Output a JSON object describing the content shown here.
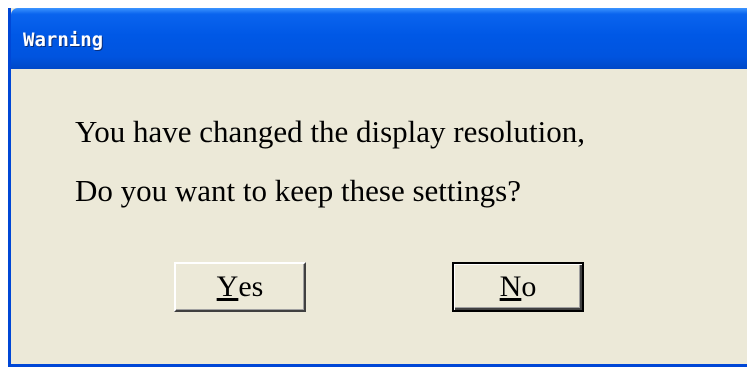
{
  "window": {
    "title": "Warning"
  },
  "message": {
    "line1": "You have changed the display resolution,",
    "line2": "Do you want to keep these settings?"
  },
  "buttons": {
    "yes": {
      "mnemonic": "Y",
      "rest": "es",
      "label": "Yes"
    },
    "no": {
      "mnemonic": "N",
      "rest": "o",
      "label": "No"
    }
  },
  "colors": {
    "title_bar": "#0058e6",
    "dialog_face": "#ece9d8",
    "title_text": "#ffffff"
  }
}
